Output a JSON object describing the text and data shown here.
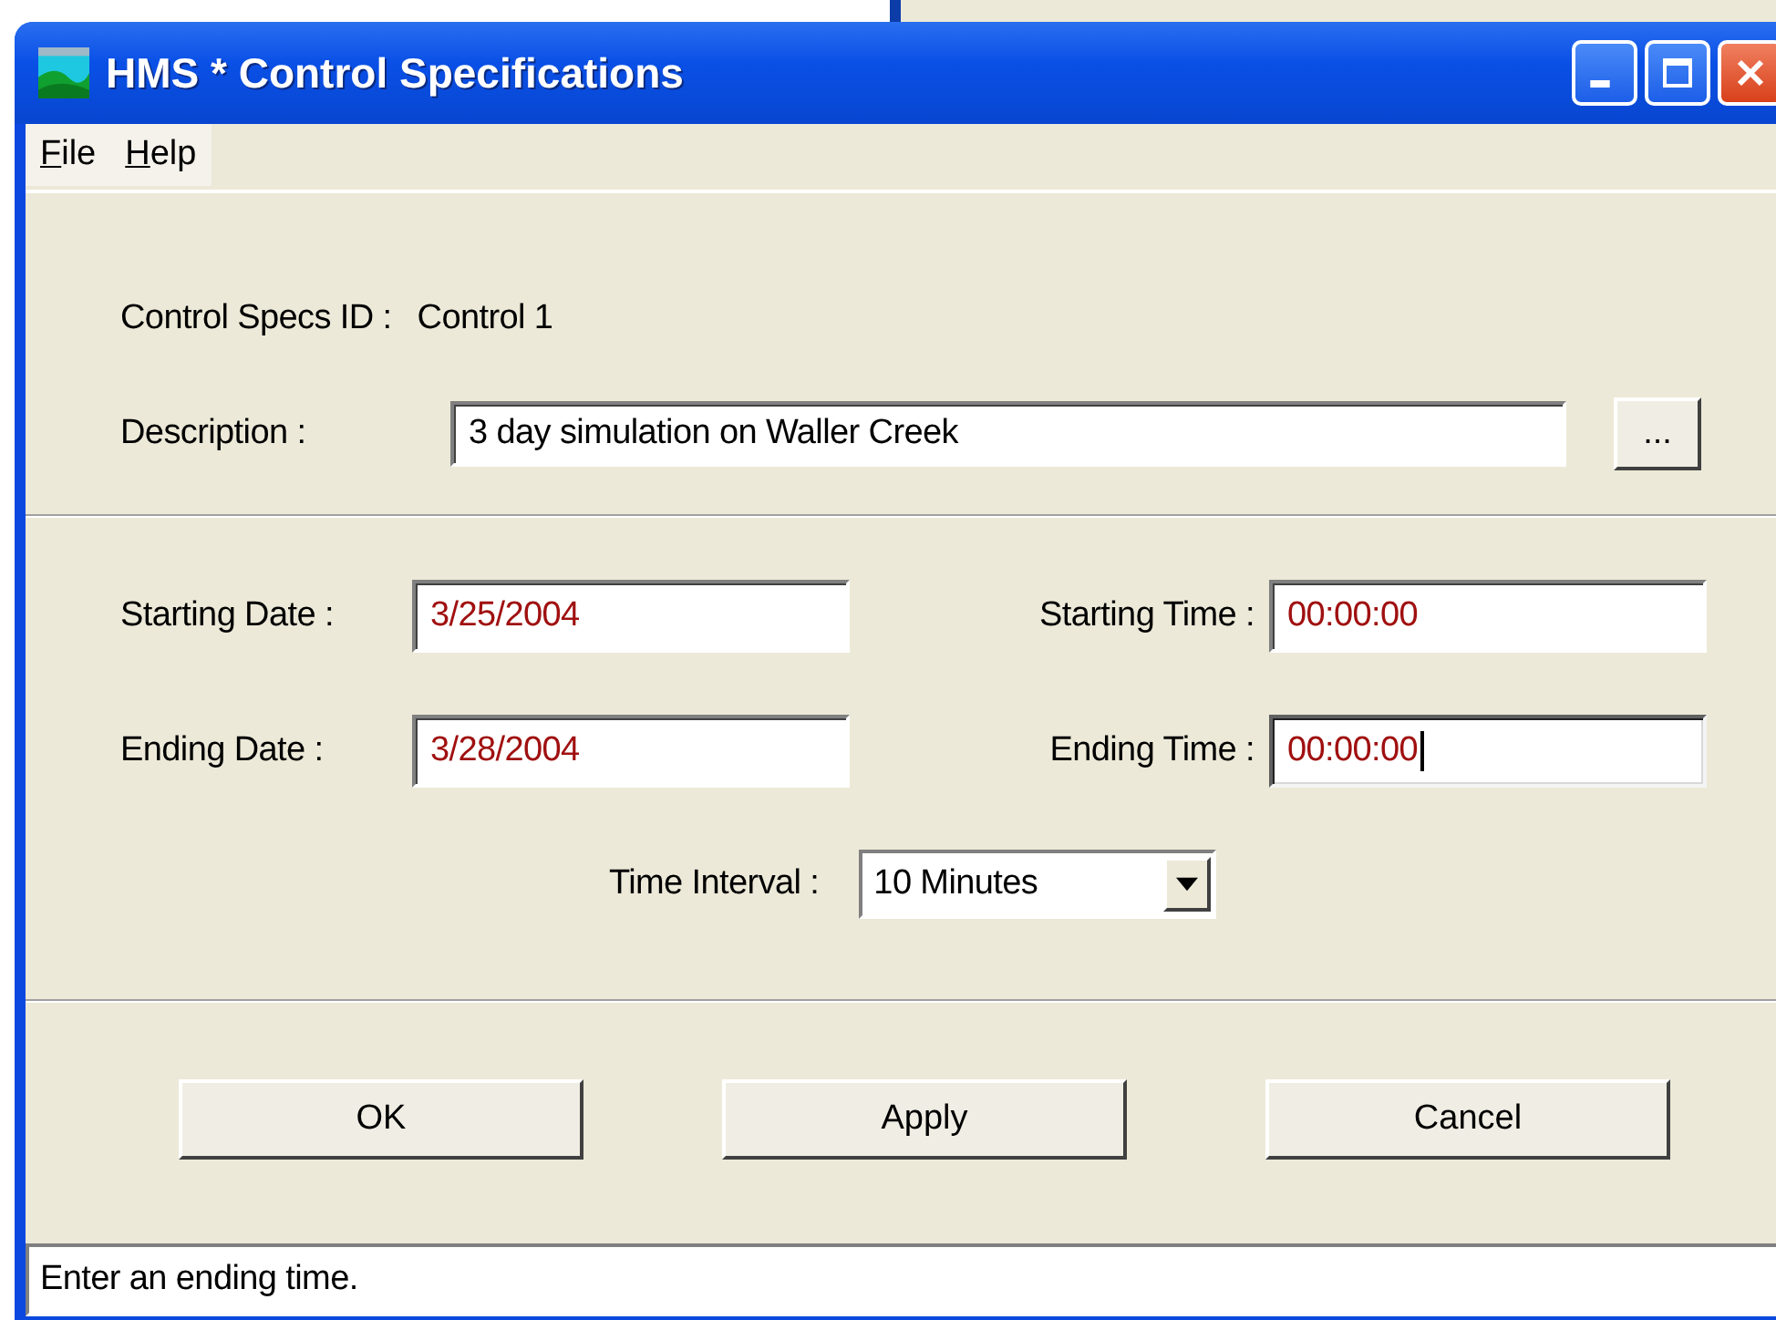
{
  "window": {
    "title": "HMS * Control Specifications"
  },
  "menu": [
    {
      "label": "File"
    },
    {
      "label": "Help"
    }
  ],
  "control_specs_id": {
    "label": "Control Specs ID :",
    "value": "Control 1"
  },
  "description": {
    "label": "Description :",
    "value": "3 day simulation on Waller Creek",
    "browse_button": "..."
  },
  "fields": [
    {
      "label": "Starting Date :",
      "value": "3/25/2004",
      "focused": false
    },
    {
      "label": "Starting Time :",
      "value": "00:00:00",
      "focused": false
    },
    {
      "label": "Ending Date :",
      "value": "3/28/2004",
      "focused": false
    },
    {
      "label": "Ending Time :",
      "value": "00:00:00",
      "focused": true
    }
  ],
  "time_interval": {
    "label": "Time Interval :",
    "value": "10 Minutes"
  },
  "buttons": [
    "OK",
    "Apply",
    "Cancel"
  ],
  "status_bar": "Enter an ending time."
}
